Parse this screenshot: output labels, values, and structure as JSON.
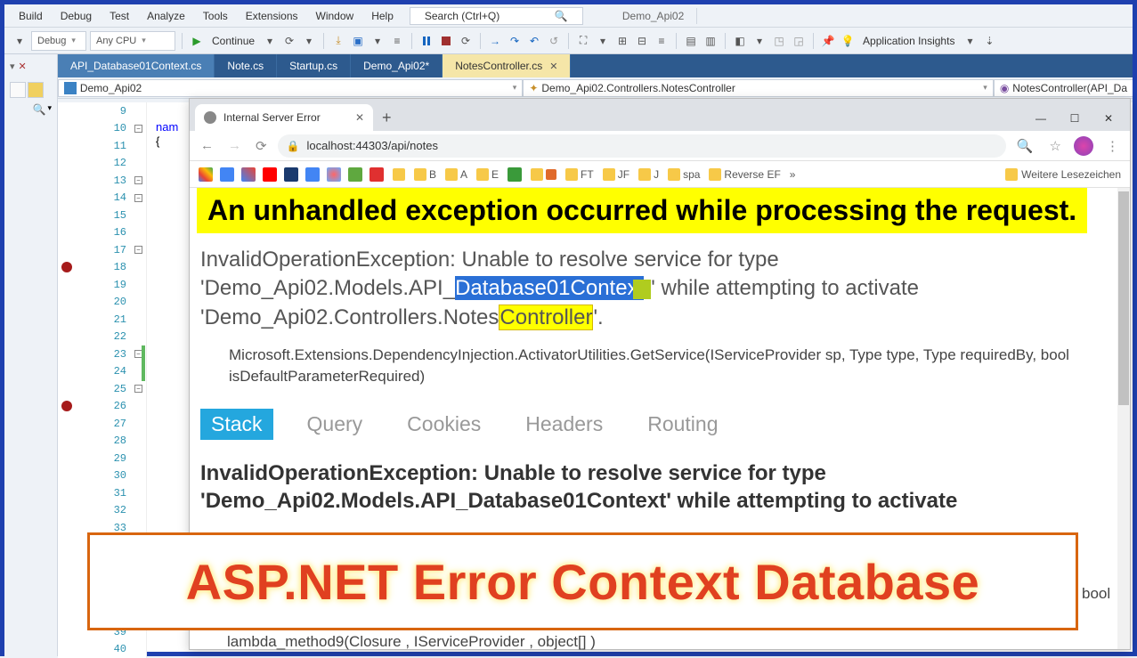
{
  "menu": {
    "items": [
      "Build",
      "Debug",
      "Test",
      "Analyze",
      "Tools",
      "Extensions",
      "Window",
      "Help"
    ],
    "search_placeholder": "Search (Ctrl+Q)",
    "context_tab": "Demo_Api02"
  },
  "toolbar": {
    "config": "Debug",
    "platform": "Any CPU",
    "continue": "Continue",
    "insights": "Application Insights"
  },
  "tabs": [
    {
      "label": "API_Database01Context.cs"
    },
    {
      "label": "Note.cs"
    },
    {
      "label": "Startup.cs"
    },
    {
      "label": "Demo_Api02*"
    },
    {
      "label": "NotesController.cs",
      "active": true
    }
  ],
  "crumbs": {
    "project": "Demo_Api02",
    "class": "Demo_Api02.Controllers.NotesController",
    "method": "NotesController(API_Da"
  },
  "code": {
    "nam": "nam",
    "brace": "{"
  },
  "lines": {
    "start": 9,
    "end": 40,
    "breakpoints": [
      18,
      26
    ],
    "folds": [
      10,
      13,
      14,
      17,
      23,
      25
    ],
    "greenbar_at": 23
  },
  "chrome": {
    "tab_title": "Internal Server Error",
    "url": "localhost:44303/api/notes",
    "bookmarks": [
      "B",
      "A",
      "E",
      "FT",
      "JF",
      "J",
      "spa",
      "Reverse EF"
    ],
    "more_bookmarks": "Weitere Lesezeichen"
  },
  "error": {
    "heading": "An unhandled exception occurred while processing the request.",
    "exc_pre": "InvalidOperationException: Unable to resolve service for type 'Demo_Api02.Models.API_",
    "exc_sel": "Database01Context",
    "exc_mid": "' while attempting to activate 'Demo_Api02.Controllers.Notes",
    "exc_ctrl": "Controller",
    "exc_end": "'.",
    "frame": "Microsoft.Extensions.DependencyInjection.ActivatorUtilities.GetService(IServiceProvider sp, Type type, Type requiredBy, bool isDefaultParameterRequired)",
    "tabs": [
      "Stack",
      "Query",
      "Cookies",
      "Headers",
      "Routing"
    ],
    "detail": "InvalidOperationException: Unable to resolve service for type 'Demo_Api02.Models.API_Database01Context' while attempting to activate",
    "stray_bool": "bool",
    "stray_lambda": "lambda_method9(Closure , IServiceProvider , object[] )"
  },
  "banner": "ASP.NET Error Context Database"
}
